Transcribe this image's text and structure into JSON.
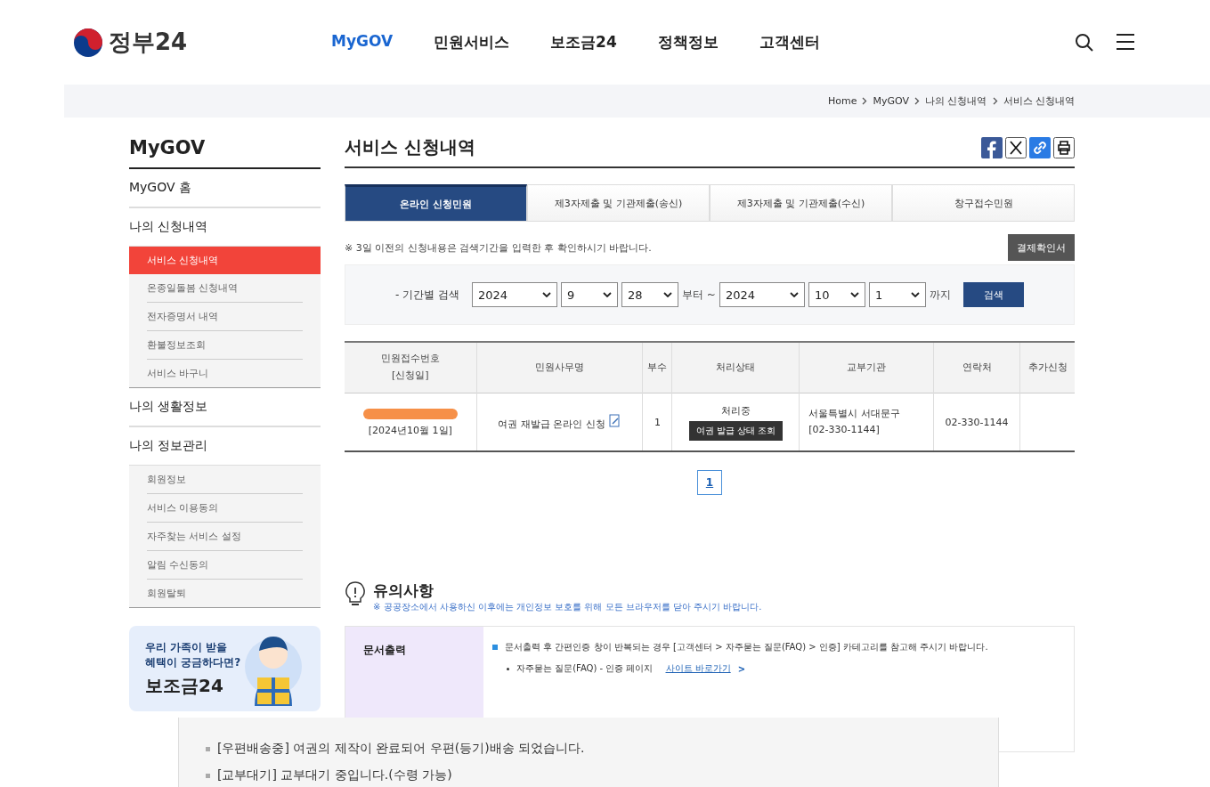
{
  "header": {
    "logo": "정부24",
    "nav": [
      {
        "label": "MyGOV",
        "selected": true
      },
      {
        "label": "민원서비스",
        "selected": false
      },
      {
        "label": "보조금24",
        "selected": false
      },
      {
        "label": "정책정보",
        "selected": false
      },
      {
        "label": "고객센터",
        "selected": false
      }
    ]
  },
  "breadcrumb": [
    "Home",
    "MyGOV",
    "나의 신청내역",
    "서비스 신청내역"
  ],
  "sidebar": {
    "title": "MyGOV",
    "sections": [
      {
        "label": "MyGOV 홈"
      },
      {
        "label": "나의 신청내역",
        "children": [
          {
            "label": "서비스 신청내역",
            "selected": true
          },
          {
            "label": "온종일돌봄 신청내역",
            "selected": false
          },
          {
            "label": "전자증명서 내역",
            "selected": false
          },
          {
            "label": "환불정보조회",
            "selected": false
          },
          {
            "label": "서비스 바구니",
            "selected": false
          }
        ]
      },
      {
        "label": "나의 생활정보"
      },
      {
        "label": "나의 정보관리",
        "children": [
          {
            "label": "회원정보",
            "selected": false
          },
          {
            "label": "서비스 이용동의",
            "selected": false
          },
          {
            "label": "자주찾는 서비스 설정",
            "selected": false
          },
          {
            "label": "알림 수신동의",
            "selected": false
          },
          {
            "label": "회원탈퇴",
            "selected": false
          }
        ]
      }
    ],
    "banner": {
      "lines": [
        "우리 가족이 받을",
        "혜택이 궁금하다면?"
      ],
      "brand": "보조금24"
    }
  },
  "page_title": "서비스 신청내역",
  "tabs": [
    {
      "label": "온라인 신청민원",
      "selected": true
    },
    {
      "label": "제3자제출 및 기관제출(송신)",
      "selected": false
    },
    {
      "label": "제3자제출 및 기관제출(수신)",
      "selected": false
    },
    {
      "label": "창구접수민원",
      "selected": false
    }
  ],
  "notice": "※ 3일 이전의 신청내용은 검색기간을 입력한 후 확인하시기 바랍니다.",
  "receipt_button": "결제확인서",
  "search": {
    "label": "- 기간별 검색",
    "from": [
      "2024",
      "9",
      "28"
    ],
    "from_suffix": "부터 ~",
    "to": [
      "2024",
      "10",
      "1"
    ],
    "to_suffix": "까지",
    "button": "검색"
  },
  "table": {
    "columns": [
      [
        "민원접수번호",
        "[신청일]"
      ],
      [
        "민원사무명"
      ],
      [
        "부수"
      ],
      [
        "처리상태"
      ],
      [
        "교부기관"
      ],
      [
        "연락처"
      ],
      [
        "추가신청"
      ]
    ],
    "rows": [
      {
        "date": "[2024년10월 1일]",
        "service": "여권 재발급 온라인 신청",
        "copies": "1",
        "status": "처리중",
        "status_button": "여권 발급 상태 조회",
        "agency": [
          "서울특별시 서대문구",
          "[02-330-1144]"
        ],
        "contact": "02-330-1144"
      }
    ]
  },
  "pagination": [
    {
      "label": "1",
      "selected": true
    }
  ],
  "notes": {
    "title": "유의사항",
    "subtitle": "※ 공공장소에서 사용하신 이후에는 개인정보 보호를 위해 모든 브라우저를 닫아 주시기 바랍니다.",
    "heading": "문서출력",
    "item": "문서출력 후 간편인증 창이 반복되는 경우 [고객센터 > 자주묻는 질문(FAQ) > 인증] 카테고리를 참고해 주시기 바랍니다.",
    "sub": "자주묻는 질문(FAQ) - 인증 페이지",
    "link": "사이트 바로가기",
    "link_arrow": ">"
  },
  "overlay": [
    "[우편배송중] 여권의 제작이 완료되어 우편(등기)배송 되었습니다.",
    "[교부대기] 교부대기 중입니다.(수령 가능)"
  ]
}
